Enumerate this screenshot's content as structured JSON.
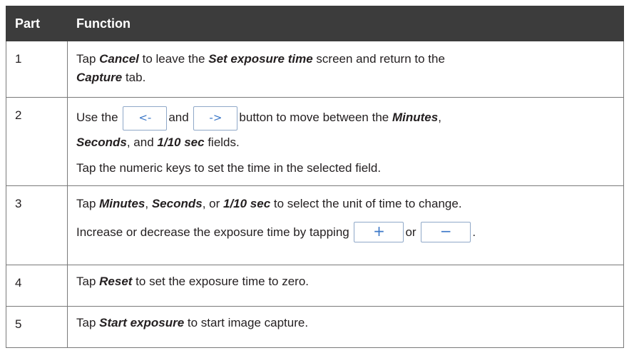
{
  "table": {
    "headers": {
      "part": "Part",
      "function": "Function"
    },
    "rows": [
      {
        "part": "1",
        "lines": [
          [
            "Tap ",
            "Cancel",
            " to leave the ",
            "Set exposure time",
            " screen and return to the ",
            "Capture",
            " tab."
          ]
        ]
      },
      {
        "part": "2",
        "line1": {
          "pre": "Use the ",
          "button_left": "<-",
          "mid": "and",
          "button_right": "->",
          "post": "button to move between the ",
          "minutes": "Minutes",
          "comma": ","
        },
        "line2": {
          "seconds": "Seconds",
          "and": ", and ",
          "tenth": "1/10 sec",
          "fields": " fields."
        },
        "line3": "Tap the numeric keys to set the time in the selected field."
      },
      {
        "part": "3",
        "line1": {
          "tap": "Tap ",
          "minutes": "Minutes",
          "c1": ", ",
          "seconds": "Seconds",
          "or": ", or ",
          "tenth": "1/10 sec",
          "rest": " to select the unit of time to change."
        },
        "line2": {
          "pre": "Increase or decrease the exposure time by tapping ",
          "plus": "+",
          "or": "or",
          "minus": "−",
          "end": "."
        }
      },
      {
        "part": "4",
        "tap": "Tap ",
        "reset": "Reset",
        "rest": " to set the exposure time to zero."
      },
      {
        "part": "5",
        "tap": "Tap ",
        "start": "Start exposure",
        "rest": " to start image capture."
      }
    ]
  }
}
